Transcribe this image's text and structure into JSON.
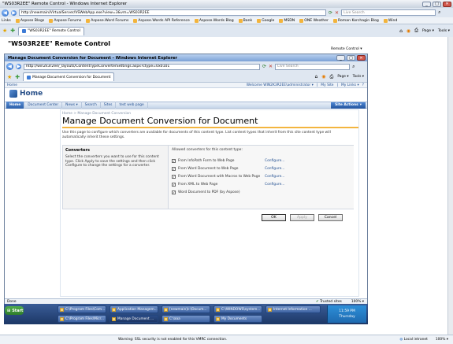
{
  "outer_window": {
    "title": "\"WS03R2EE\" Remote Control - Windows Internet Explorer",
    "address": "http://newmain/VirtualServer/VSWebApp.exe?view=3&vm=WS03R2EE",
    "search_placeholder": "Live Search",
    "links_label": "Links",
    "links": [
      "Aspose Blogs",
      "Aspose Forums",
      "Aspose.Word Forums",
      "Aspose.Words API Reference",
      "Aspose.Words Blog",
      "Bank",
      "Google",
      "MSDN",
      "ONE Weather",
      "Roman Korchagin Blog",
      "Wind"
    ],
    "tab": "\"WS03R2EE\" Remote Control",
    "tools": {
      "page": "Page",
      "tools": "Tools"
    },
    "status_warning": "Warning: SSL security is not enabled for this VMRC connection.",
    "zone": "Local intranet",
    "zoom": "100%"
  },
  "remote_control": {
    "heading": "\"WS03R2EE\" Remote Control",
    "menu": "Remote Control"
  },
  "inner_window": {
    "title": "Manage Document Conversion for Document - Windows Internet Explorer",
    "address": "http://win2k3r2ee/_layouts/ContentTypeConverterSettings.aspx?ctype=0x0101",
    "search_placeholder": "Live Search",
    "tab": "Manage Document Conversion for Document",
    "tools": {
      "page": "Page",
      "tools": "Tools"
    },
    "status_left": "Done",
    "zone": "Trusted sites",
    "zoom": "100%"
  },
  "sharepoint": {
    "top_left": "Home",
    "welcome": "Welcome WIN2K3R2EE\\administrator",
    "my_site": "My Site",
    "my_links": "My Links",
    "site_title": "Home",
    "nav": [
      "Home",
      "Document Center",
      "News",
      "Search",
      "Sites",
      "test web page"
    ],
    "site_actions": "Site Actions",
    "breadcrumb": "Home > Manage Document Conversion",
    "page_title": "Manage Document Conversion for Document",
    "description": "Use this page to configure which converters are available for documents of this content type. List content types that inherit from this site content type will automatically inherit these settings.",
    "converters_heading": "Converters",
    "converters_help": "Select the converters you want to use for this content type. Click Apply to save the settings and then click Configure to change the settings for a converter.",
    "allowed_label": "Allowed converters for this content type:",
    "converters": [
      {
        "name": "From InfoPath Form to Web Page",
        "checked": "✓",
        "configure": "Configure..."
      },
      {
        "name": "From Word Document to Web Page",
        "checked": "✓",
        "configure": "Configure..."
      },
      {
        "name": "From Word Document with Macros to Web Page",
        "checked": "✓",
        "configure": "Configure..."
      },
      {
        "name": "From XML to Web Page",
        "checked": "✓",
        "configure": "Configure..."
      },
      {
        "name": "Word Document to PDF (by Aspose)",
        "checked": "✓",
        "configure": ""
      }
    ],
    "buttons": {
      "ok": "OK",
      "apply": "Apply",
      "cancel": "Cancel"
    }
  },
  "taskbar": {
    "start": "Start",
    "items": [
      "C:\\Program Files\\Com...",
      "Application Managem...",
      "[newmain]c:\\Docum...",
      "C:\\WINDOWS\\system...",
      "Internet Information ...",
      "C:\\Program Files\\Micr...",
      "Manage Document ...",
      "C:\\aaa",
      "My Documents"
    ],
    "time": "11:59 PM",
    "day": "Thursday"
  },
  "colors": {
    "accent": "#f3b53f",
    "nav_active": "#2b5fa8",
    "link": "#1f4d8f"
  }
}
